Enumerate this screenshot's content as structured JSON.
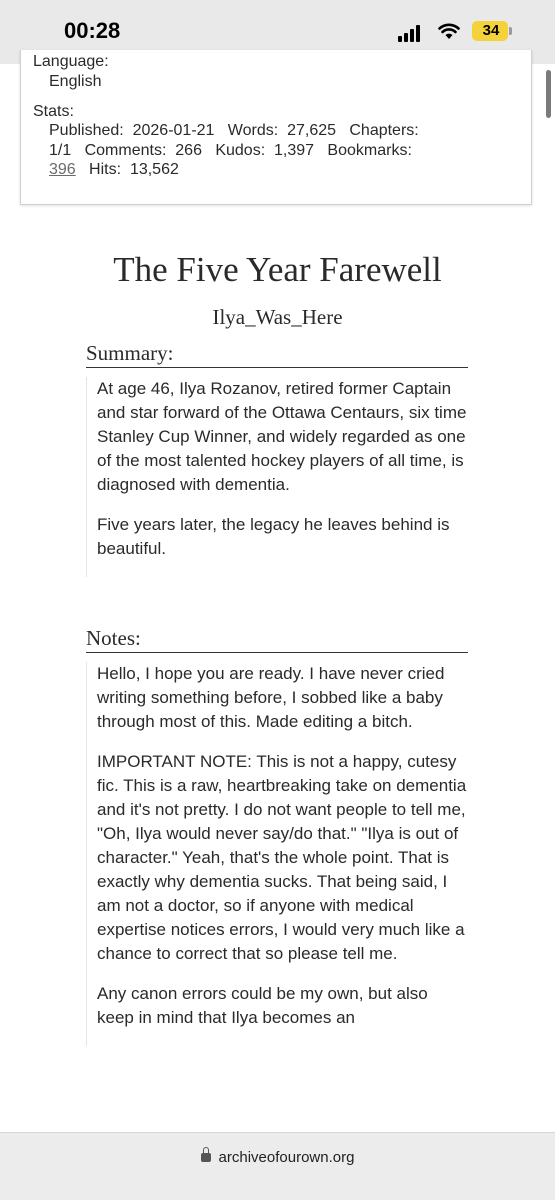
{
  "status_bar": {
    "time": "00:28",
    "battery": "34"
  },
  "meta": {
    "language_label": "Language:",
    "language_value": "English",
    "stats_label": "Stats:",
    "published_label": "Published:",
    "published_value": "2026-01-21",
    "words_label": "Words:",
    "words_value": "27,625",
    "chapters_label": "Chapters:",
    "chapters_value": "1/1",
    "comments_label": "Comments:",
    "comments_value": "266",
    "kudos_label": "Kudos:",
    "kudos_value": "1,397",
    "bookmarks_label": "Bookmarks:",
    "bookmarks_value": "396",
    "hits_label": "Hits:",
    "hits_value": "13,562"
  },
  "work": {
    "title": "The Five Year Farewell",
    "author": "Ilya_Was_Here",
    "summary_heading": "Summary:",
    "summary": [
      "At age 46, Ilya Rozanov, retired former Captain and star forward of the Ottawa Centaurs, six time Stanley Cup Winner, and widely regarded as one of the most talented hockey players of all time, is diagnosed with dementia.",
      "Five years later, the legacy he leaves behind is beautiful."
    ],
    "notes_heading": "Notes:",
    "notes": [
      "Hello, I hope you are ready. I have never cried writing something before, I sobbed like a baby through most of this. Made editing a bitch.",
      "IMPORTANT NOTE: This is not a happy, cutesy fic. This is a raw, heartbreaking take on dementia and it's not pretty. I do not want people to tell me, \"Oh, Ilya would never say/do that.\" \"Ilya is out of character.\" Yeah, that's the whole point. That is exactly why dementia sucks. That being said, I am not a doctor, so if anyone with medical expertise notices errors, I would very much like a chance to correct that so please tell me.",
      "Any canon errors could be my own, but also keep in mind that Ilya becomes an"
    ]
  },
  "browser": {
    "url": "archiveofourown.org",
    "icons": [
      "signal-icon",
      "wifi-icon",
      "battery-icon",
      "lock-icon"
    ]
  }
}
